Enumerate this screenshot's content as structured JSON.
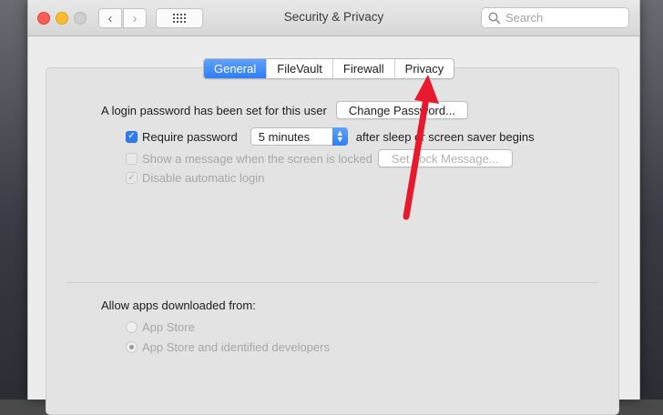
{
  "window": {
    "title": "Security & Privacy"
  },
  "toolbar": {
    "search_placeholder": "Search",
    "back_icon": "chevron-left-icon",
    "forward_icon": "chevron-right-icon",
    "grid_icon": "show-all-grid-icon"
  },
  "tabs": [
    {
      "label": "General",
      "active": true
    },
    {
      "label": "FileVault",
      "active": false
    },
    {
      "label": "Firewall",
      "active": false
    },
    {
      "label": "Privacy",
      "active": false
    }
  ],
  "general": {
    "login_text": "A login password has been set for this user",
    "change_password_label": "Change Password...",
    "require_password": {
      "label": "Require password",
      "checked": true
    },
    "require_delay": "5 minutes",
    "after_text": "after sleep or screen saver begins",
    "show_message": {
      "label": "Show a message when the screen is locked",
      "checked": false,
      "enabled": false
    },
    "set_lock_message_label": "Set Lock Message...",
    "disable_auto_login": {
      "label": "Disable automatic login",
      "checked": true,
      "enabled": false
    }
  },
  "downloads": {
    "heading": "Allow apps downloaded from:",
    "options": [
      {
        "label": "App Store",
        "selected": false
      },
      {
        "label": "App Store and identified developers",
        "selected": true
      }
    ]
  },
  "annotation": {
    "arrow_color": "#e8192c"
  },
  "colors": {
    "accent": "#2f7df6",
    "close": "#fc5f57",
    "minimize": "#fdbc2e"
  }
}
